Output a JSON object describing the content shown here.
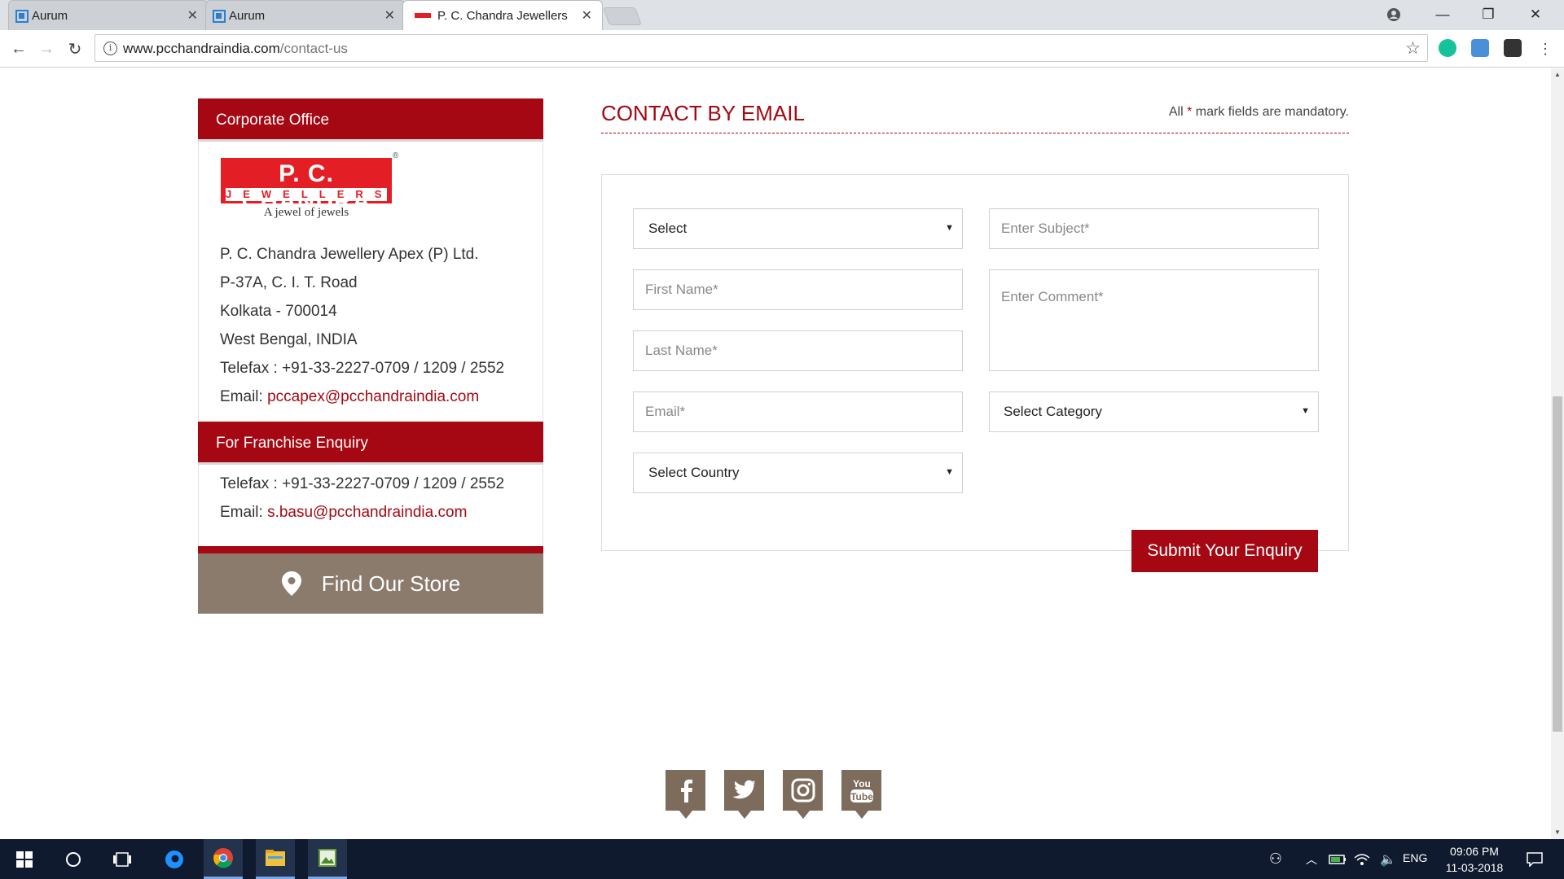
{
  "browser": {
    "tabs": [
      {
        "title": "Aurum"
      },
      {
        "title": "Aurum"
      },
      {
        "title": "P. C. Chandra Jewellers",
        "active": true
      }
    ],
    "url": {
      "host": "www.pcchandraindia.com",
      "path": "/contact-us"
    }
  },
  "left": {
    "corporate_heading": "Corporate Office",
    "logo": {
      "line1": "P. C. CHANDRA",
      "line2": "JEWELLERS",
      "tagline": "A jewel of jewels"
    },
    "address_lines": [
      "P. C. Chandra Jewellery Apex (P) Ltd.",
      "P-37A, C. I. T. Road",
      "Kolkata - 700014",
      "West Bengal, INDIA",
      "Telefax : +91-33-2227-0709 / 1209 / 2552"
    ],
    "email_label": "Email:",
    "email": "pccapex@pcchandraindia.com",
    "franchise_heading": "For Franchise Enquiry",
    "franchise_telefax": "Telefax : +91-33-2227-0709 / 1209 / 2552",
    "franchise_email_label": "Email:",
    "franchise_email": "s.basu@pcchandraindia.com",
    "store_button": "Find Our Store"
  },
  "form": {
    "title": "CONTACT BY EMAIL",
    "mandatory_prefix": "All",
    "mandatory_star": "*",
    "mandatory_suffix": "mark fields are mandatory.",
    "title_select": "Select",
    "subject_placeholder": "Enter Subject*",
    "first_name_placeholder": "First Name*",
    "comment_placeholder": "Enter Comment*",
    "last_name_placeholder": "Last Name*",
    "email_placeholder": "Email*",
    "category_select": "Select Category",
    "country_select": "Select Country",
    "submit": "Submit Your Enquiry"
  },
  "social": [
    "facebook",
    "twitter",
    "instagram",
    "youtube"
  ],
  "taskbar": {
    "time": "09:06 PM",
    "date": "11-03-2018",
    "lang": "ENG"
  },
  "colors": {
    "brand_red": "#a50812",
    "store_brown": "#8b7b6c"
  }
}
